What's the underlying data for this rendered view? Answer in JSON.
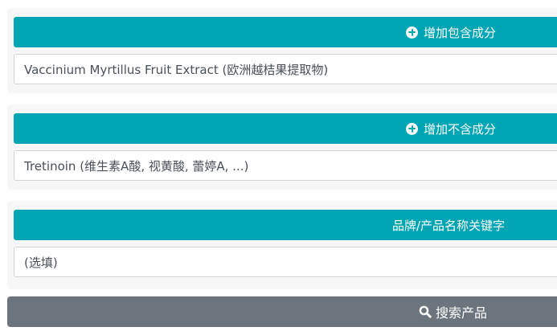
{
  "include_section": {
    "add_button_label": "增加包含成分",
    "input_value": "Vaccinium Myrtillus Fruit Extract (欧洲越桔果提取物)"
  },
  "exclude_section": {
    "add_button_label": "增加不含成分",
    "input_value": "Tretinoin (维生素A酸, 视黄酸, 蕾婷A, ...)"
  },
  "keyword_section": {
    "header_label": "品牌/产品名称关键字",
    "input_placeholder": "(选填)"
  },
  "search_button": {
    "label": "搜索产品"
  },
  "colors": {
    "accent": "#00a5b5",
    "panel_bg": "#f7f7f7",
    "search_button_bg": "#6c757d"
  }
}
